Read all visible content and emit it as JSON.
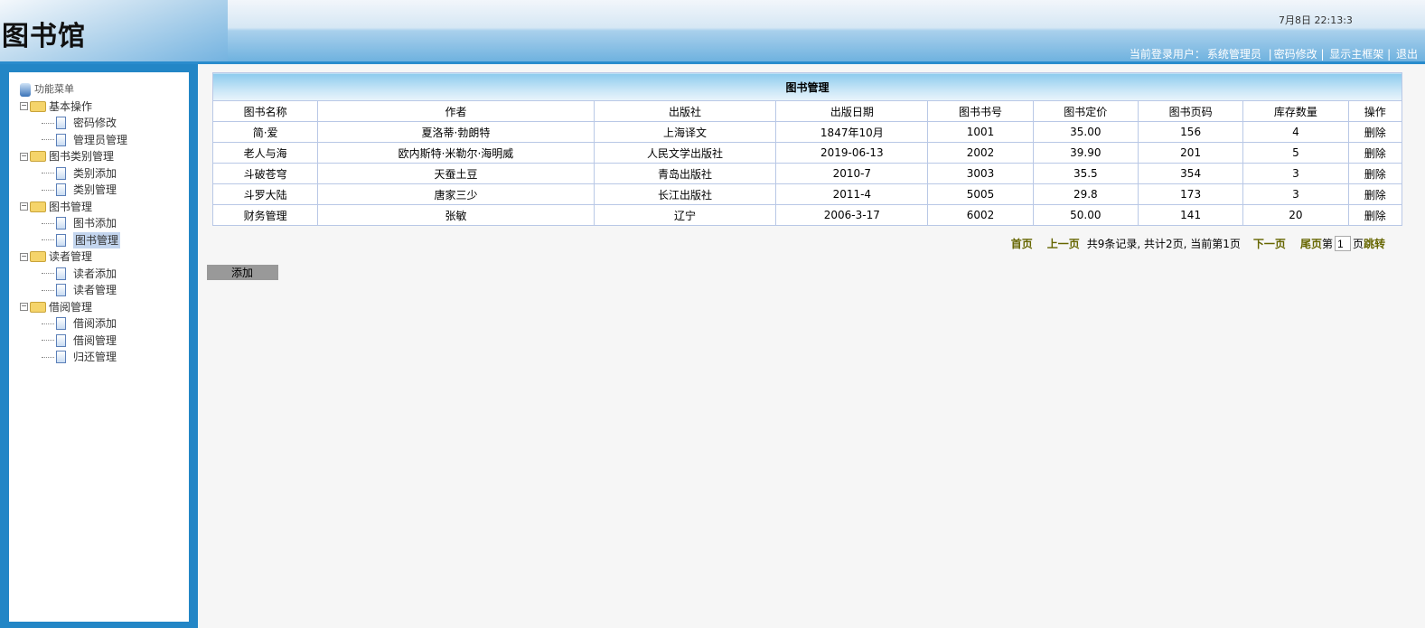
{
  "header": {
    "logo": "图书馆",
    "clock": "7月8日 22:13:3",
    "user_label": "当前登录用户：",
    "user_name": "系统管理员",
    "links": [
      "密码修改",
      "显示主框架",
      "退出"
    ]
  },
  "menu": {
    "root": "功能菜单",
    "groups": [
      {
        "label": "基本操作",
        "items": [
          "密码修改",
          "管理员管理"
        ]
      },
      {
        "label": "图书类别管理",
        "items": [
          "类别添加",
          "类别管理"
        ]
      },
      {
        "label": "图书管理",
        "items": [
          "图书添加",
          "图书管理"
        ]
      },
      {
        "label": "读者管理",
        "items": [
          "读者添加",
          "读者管理"
        ]
      },
      {
        "label": "借阅管理",
        "items": [
          "借阅添加",
          "借阅管理",
          "归还管理"
        ]
      }
    ],
    "selected": "图书管理"
  },
  "table": {
    "title": "图书管理",
    "columns": [
      "图书名称",
      "作者",
      "出版社",
      "出版日期",
      "图书书号",
      "图书定价",
      "图书页码",
      "库存数量",
      "操作"
    ],
    "rows": [
      [
        "简·爱",
        "夏洛蒂·勃朗特",
        "上海译文",
        "1847年10月",
        "1001",
        "35.00",
        "156",
        "4",
        "删除"
      ],
      [
        "老人与海",
        "欧内斯特·米勒尔·海明威",
        "人民文学出版社",
        "2019-06-13",
        "2002",
        "39.90",
        "201",
        "5",
        "删除"
      ],
      [
        "斗破苍穹",
        "天蚕土豆",
        "青岛出版社",
        "2010-7",
        "3003",
        "35.5",
        "354",
        "3",
        "删除"
      ],
      [
        "斗罗大陆",
        "唐家三少",
        "长江出版社",
        "2011-4",
        "5005",
        "29.8",
        "173",
        "3",
        "删除"
      ],
      [
        "财务管理",
        "张敏",
        "辽宁",
        "2006-3-17",
        "6002",
        "50.00",
        "141",
        "20",
        "删除"
      ]
    ]
  },
  "pager": {
    "first": "首页",
    "prev": "上一页",
    "info": "共9条记录, 共计2页, 当前第1页",
    "next": "下一页",
    "last": "尾页",
    "page_prefix": "第",
    "page_value": "1",
    "page_suffix": "页",
    "go": "跳转"
  },
  "add_button": "添加"
}
